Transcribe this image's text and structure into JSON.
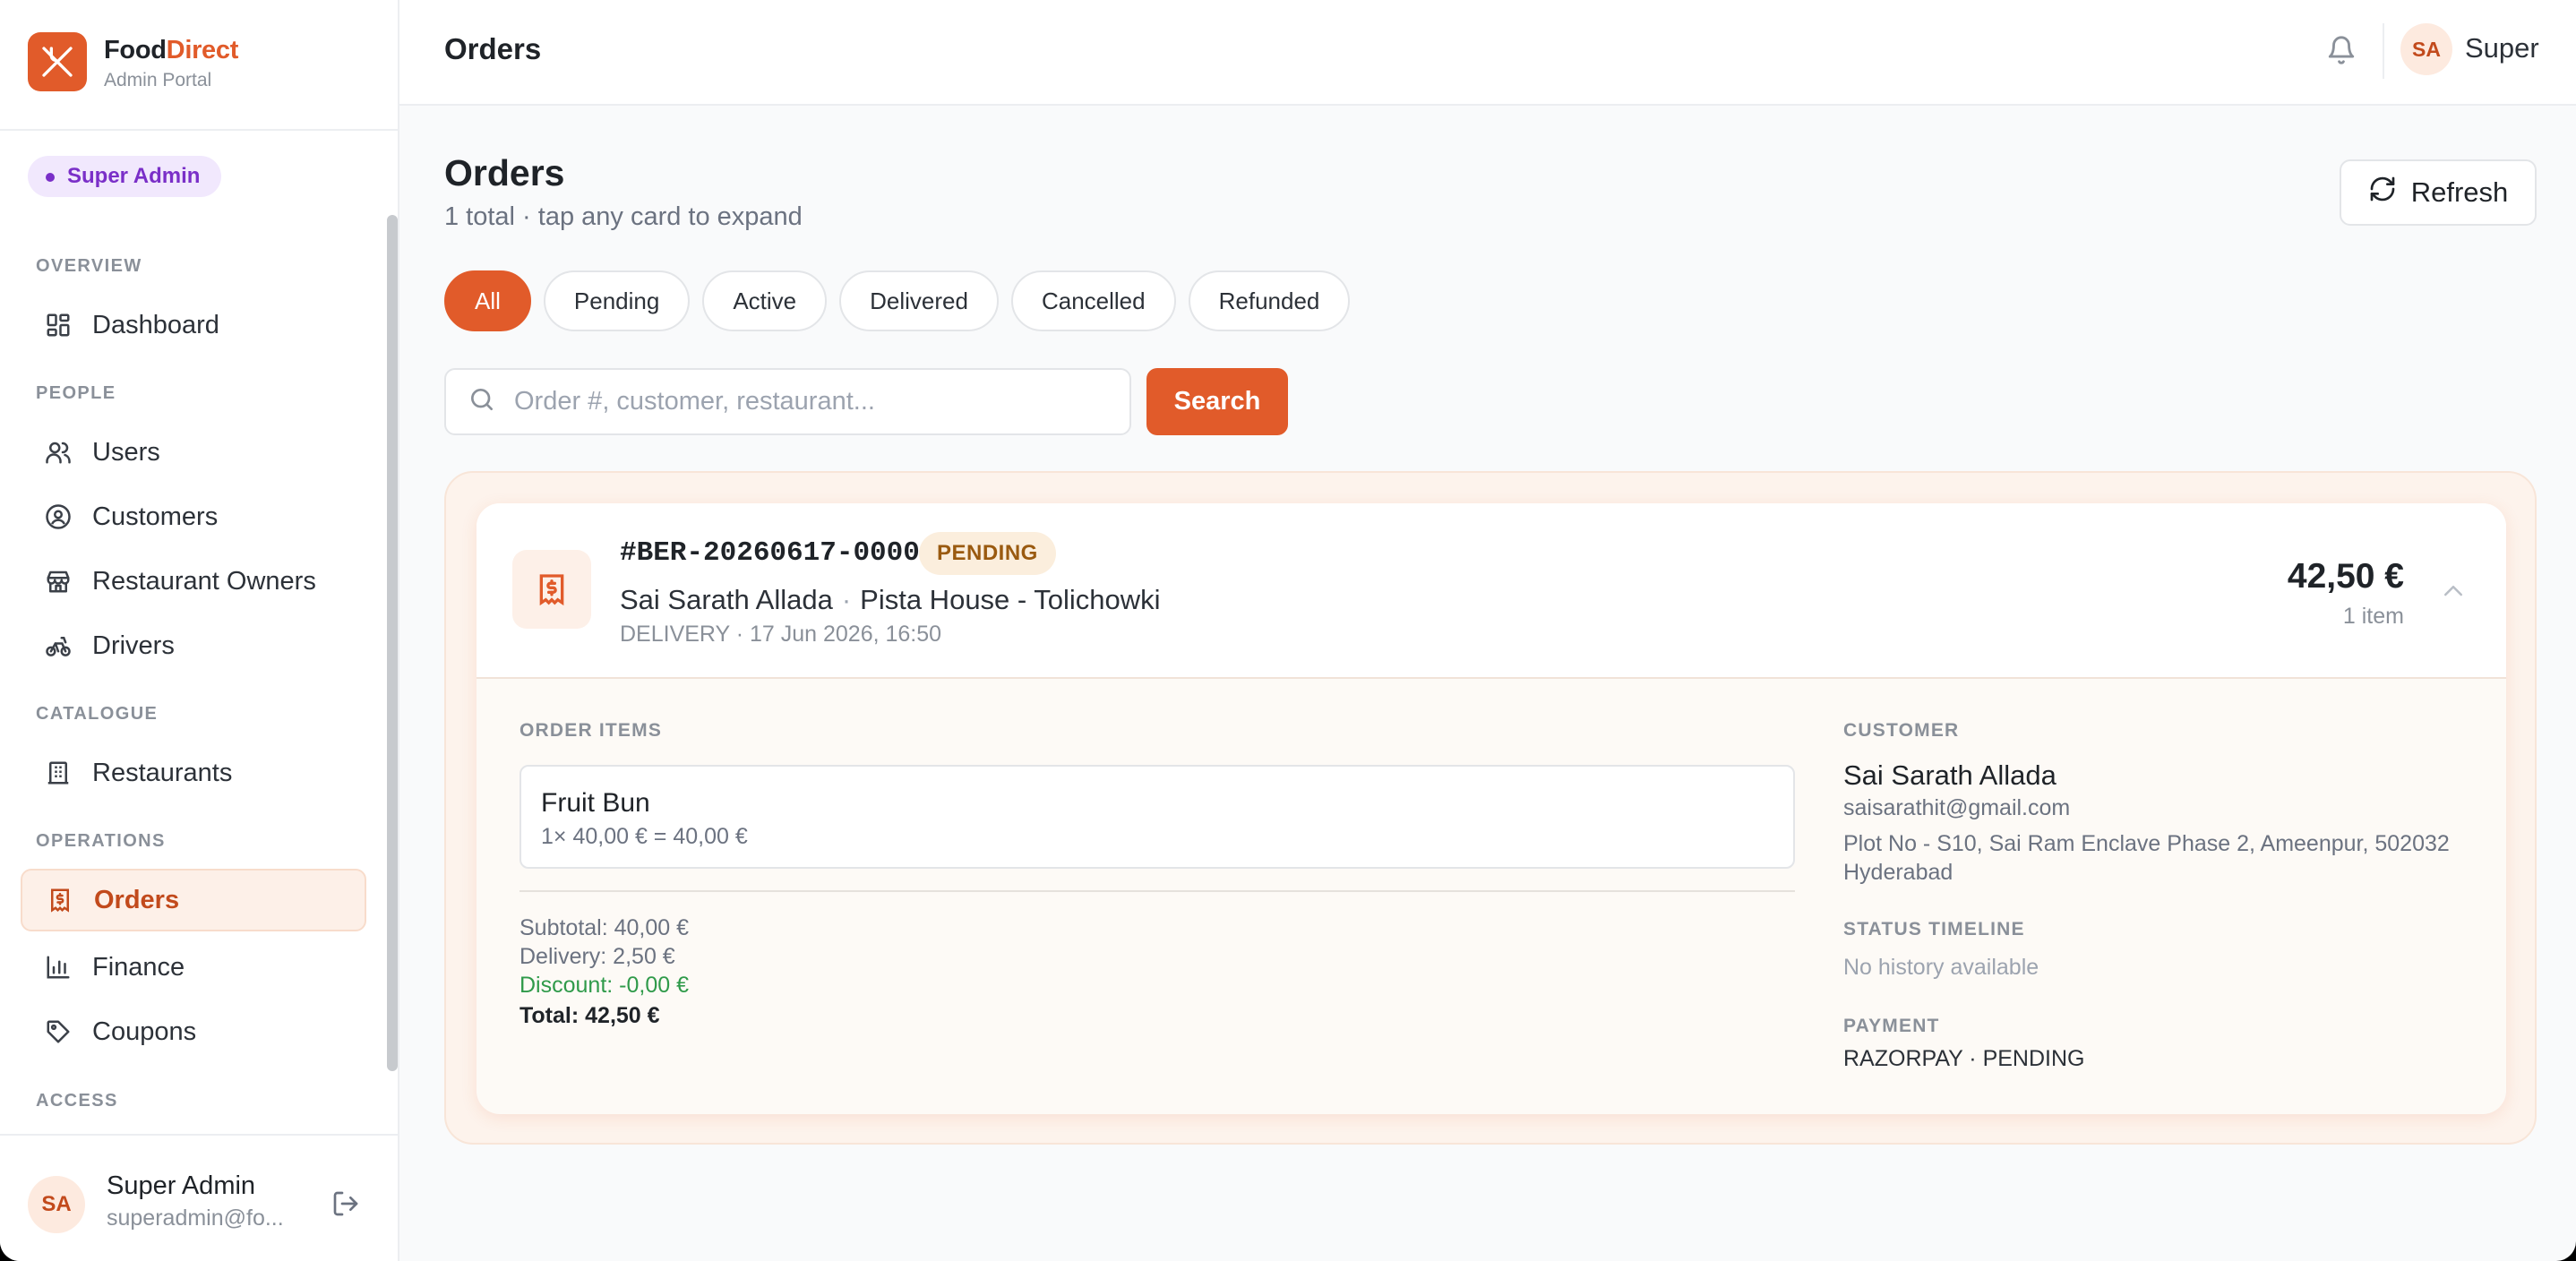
{
  "brand": {
    "name_part1": "Food",
    "name_part2": "Direct",
    "subtitle": "Admin Portal",
    "accent_color": "#e15b2a",
    "logo_icon": "utensils-icon"
  },
  "role_badge": "Super Admin",
  "sidebar": {
    "sections": [
      {
        "label": "OVERVIEW",
        "items": [
          {
            "label": "Dashboard",
            "icon": "grid-icon"
          }
        ]
      },
      {
        "label": "PEOPLE",
        "items": [
          {
            "label": "Users",
            "icon": "users-icon"
          },
          {
            "label": "Customers",
            "icon": "user-circle-icon"
          },
          {
            "label": "Restaurant Owners",
            "icon": "store-icon"
          },
          {
            "label": "Drivers",
            "icon": "bike-icon"
          }
        ]
      },
      {
        "label": "CATALOGUE",
        "items": [
          {
            "label": "Restaurants",
            "icon": "building-icon"
          }
        ]
      },
      {
        "label": "OPERATIONS",
        "items": [
          {
            "label": "Orders",
            "icon": "receipt-icon",
            "active": true
          },
          {
            "label": "Finance",
            "icon": "bar-chart-icon"
          },
          {
            "label": "Coupons",
            "icon": "tag-icon"
          }
        ]
      },
      {
        "label": "ACCESS",
        "items": []
      }
    ],
    "user": {
      "initials": "SA",
      "name": "Super Admin",
      "email": "superadmin@fo..."
    }
  },
  "topbar": {
    "title": "Orders",
    "user_initials": "SA",
    "user_name": "Super"
  },
  "main": {
    "title": "Orders",
    "subtitle": "1 total · tap any card to expand",
    "refresh_label": "Refresh",
    "filters": [
      "All",
      "Pending",
      "Active",
      "Delivered",
      "Cancelled",
      "Refunded"
    ],
    "active_filter": "All",
    "search": {
      "placeholder": "Order #, customer, restaurant...",
      "value": "",
      "button_label": "Search"
    }
  },
  "order": {
    "number": "#BER-20260617-00001",
    "status": "PENDING",
    "customer": "Sai Sarath Allada",
    "separator": "·",
    "restaurant": "Pista House - Tolichowki",
    "meta": "DELIVERY · 17 Jun 2026, 16:50",
    "total": "42,50 €",
    "item_count": "1 item",
    "items_label": "ORDER ITEMS",
    "items": [
      {
        "name": "Fruit Bun",
        "price_line": "1× 40,00 € = 40,00 €"
      }
    ],
    "summary": {
      "subtotal": "Subtotal: 40,00 €",
      "delivery": "Delivery: 2,50 €",
      "discount": "Discount: -0,00 €",
      "total": "Total: 42,50 €"
    },
    "customer_label": "CUSTOMER",
    "customer_name": "Sai Sarath Allada",
    "customer_email": "saisarathit@gmail.com",
    "customer_address": "Plot No - S10, Sai Ram Enclave Phase 2, Ameenpur, 502032 Hyderabad",
    "timeline_label": "STATUS TIMELINE",
    "timeline_empty": "No history available",
    "payment_label": "PAYMENT",
    "payment_value": "RAZORPAY · PENDING"
  }
}
